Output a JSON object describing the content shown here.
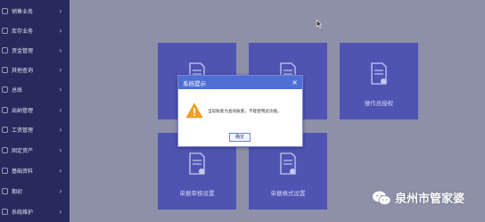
{
  "sidebar": {
    "items": [
      {
        "label": "销售业务",
        "icon": "cart-icon"
      },
      {
        "label": "库存业务",
        "icon": "box-icon"
      },
      {
        "label": "资金管理",
        "icon": "money-icon"
      },
      {
        "label": "其他查询",
        "icon": "search-icon"
      },
      {
        "label": "总账",
        "icon": "ledger-icon"
      },
      {
        "label": "出纳管理",
        "icon": "cashier-icon"
      },
      {
        "label": "工资管理",
        "icon": "salary-icon"
      },
      {
        "label": "固定资产",
        "icon": "asset-icon"
      },
      {
        "label": "基础资料",
        "icon": "data-icon"
      },
      {
        "label": "期初",
        "icon": "opening-icon"
      },
      {
        "label": "系统维护",
        "icon": "settings-icon"
      }
    ],
    "arrow": "›"
  },
  "tiles": [
    {
      "label": "",
      "icon": "document-icon"
    },
    {
      "label": "",
      "icon": "document-icon"
    },
    {
      "label": "操作员授权",
      "icon": "document-icon"
    },
    {
      "label": "单据审核设置",
      "icon": "document-icon"
    },
    {
      "label": "单据格式设置",
      "icon": "document-icon"
    }
  ],
  "dialog": {
    "title": "系统提示",
    "close": "×",
    "message": "当前账套为查询账套，不能使用此功能。",
    "ok_label": "确定",
    "icon": "warning-icon"
  },
  "watermark": {
    "text": "泉州市管家婆",
    "icon": "wechat-logo-icon"
  },
  "colors": {
    "sidebar_bg": "#272a5c",
    "background": "#8e90a9",
    "tile": "#4f54b3",
    "dialog_header": "#4e6fd4",
    "warning": "#f0a020"
  }
}
